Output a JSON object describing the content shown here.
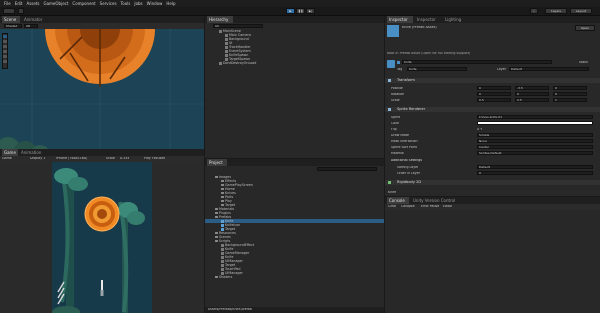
{
  "menu": [
    "File",
    "Edit",
    "Assets",
    "GameObject",
    "Component",
    "Services",
    "Tools",
    "Jobs",
    "Window",
    "Help"
  ],
  "toolbar": {
    "layers": "Layers",
    "layout": "Layout"
  },
  "scene": {
    "tabs": [
      "Scene",
      "Animator"
    ],
    "shading": "Shaded",
    "mode": "2D"
  },
  "game": {
    "tabs": [
      "Game",
      "Animation"
    ],
    "display": "Game",
    "display_num": "Display 1",
    "resolution": "iPhone (768x1160)",
    "scale_label": "Scale",
    "scale": "0.35x",
    "play": "Play Focused"
  },
  "hierarchy": {
    "tab": "Hierarchy",
    "search": "All",
    "items": [
      "MainScene",
      "Main Camera",
      "Background",
      "UI",
      "TrackHandler",
      "EventSystem",
      "KnifeSpawn",
      "TargetSpawn",
      "DontDestroyOnLoad"
    ]
  },
  "project": {
    "tab": "Project",
    "items": [
      "Images",
      "Effects",
      "GamePlayScreen",
      "Home",
      "Knives",
      "Parts",
      "Play",
      "Target",
      "Materials",
      "Plugins",
      "Prefabs",
      "Knife",
      "KnifeIcon",
      "Target",
      "Resources",
      "Scenes",
      "Scripts",
      "BackgroundEffect",
      "Knife",
      "GameManager",
      "Knife",
      "UIManager",
      "Target",
      "TouchPad",
      "UIManager",
      "Shaders"
    ],
    "footer": "Assets/Prefabs/Knife.prefab"
  },
  "inspector": {
    "tabs": [
      "Inspector",
      "Inspector",
      "Lighting"
    ],
    "object_name": "Knife (Prefab Asset)",
    "open_btn": "Open",
    "root_note": "Root in Prefab Asset (Open for full editing support)",
    "name": "Knife",
    "static": "Static",
    "tag_label": "Tag",
    "tag": "Knife",
    "layer_label": "Layer",
    "layer": "Default",
    "transform": {
      "title": "Transform",
      "rows": [
        {
          "label": "Position",
          "x": "0",
          "y": "-3.5",
          "z": "0"
        },
        {
          "label": "Rotation",
          "x": "0",
          "y": "0",
          "z": "0"
        },
        {
          "label": "Scale",
          "x": "0.5",
          "y": "0.5",
          "z": "1"
        }
      ]
    },
    "sprite": {
      "title": "Sprite Renderer",
      "rows": [
        {
          "label": "Sprite",
          "value": "knives-knife-01"
        },
        {
          "label": "Color",
          "value": ""
        },
        {
          "label": "Flip",
          "value": "X  Y"
        },
        {
          "label": "Draw Mode",
          "value": "Simple"
        },
        {
          "label": "Mask Interaction",
          "value": "None"
        },
        {
          "label": "Sprite Sort Point",
          "value": "Center"
        },
        {
          "label": "Material",
          "value": "Sprites-Default"
        }
      ],
      "additional": "Additional Settings",
      "sorting_label": "Sorting Layer",
      "sorting": "Default",
      "order_label": "Order in Layer",
      "order": "0"
    },
    "rigidbody": "Rigidbody 2D",
    "knife_footer": "Knife"
  },
  "console": {
    "tabs": [
      "Console",
      "Unity Version Control"
    ],
    "buttons": [
      "Clear",
      "Collapse",
      "Error Pause",
      "Editor"
    ]
  }
}
